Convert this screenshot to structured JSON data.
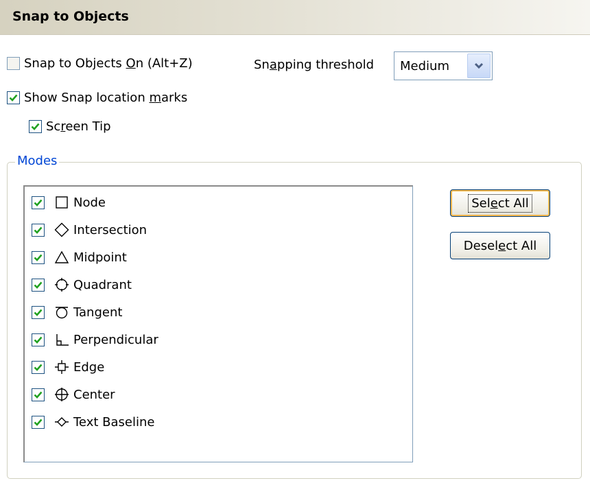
{
  "title": "Snap to Objects",
  "options": {
    "snap_on": {
      "checked": false,
      "pre": "Snap to Objects ",
      "ul": "O",
      "post": "n (Alt+Z)"
    },
    "threshold": {
      "pre": "Sn",
      "ul": "a",
      "post": "pping threshold",
      "value": "Medium"
    },
    "show_marks": {
      "checked": true,
      "pre": "Show Snap location ",
      "ul": "m",
      "post": "arks"
    },
    "screen_tip": {
      "checked": true,
      "pre": "Sc",
      "ul": "r",
      "post": "een Tip"
    }
  },
  "modes": {
    "legend": "Modes",
    "items": [
      {
        "label": "Node",
        "icon": "square-icon",
        "checked": true
      },
      {
        "label": "Intersection",
        "icon": "diamond-icon",
        "checked": true
      },
      {
        "label": "Midpoint",
        "icon": "triangle-icon",
        "checked": true
      },
      {
        "label": "Quadrant",
        "icon": "quadrant-icon",
        "checked": true
      },
      {
        "label": "Tangent",
        "icon": "tangent-icon",
        "checked": true
      },
      {
        "label": "Perpendicular",
        "icon": "perpendicular-icon",
        "checked": true
      },
      {
        "label": "Edge",
        "icon": "edge-icon",
        "checked": true
      },
      {
        "label": "Center",
        "icon": "center-icon",
        "checked": true
      },
      {
        "label": "Text Baseline",
        "icon": "text-baseline-icon",
        "checked": true
      }
    ]
  },
  "buttons": {
    "select_all": {
      "pre": "Sel",
      "ul": "e",
      "post": "ct All"
    },
    "deselect_all": {
      "pre": "Desel",
      "ul": "e",
      "post": "ct All"
    }
  },
  "colors": {
    "accent": "#0046d5",
    "check": "#21a121",
    "checkbox_border": "#1c5180"
  }
}
